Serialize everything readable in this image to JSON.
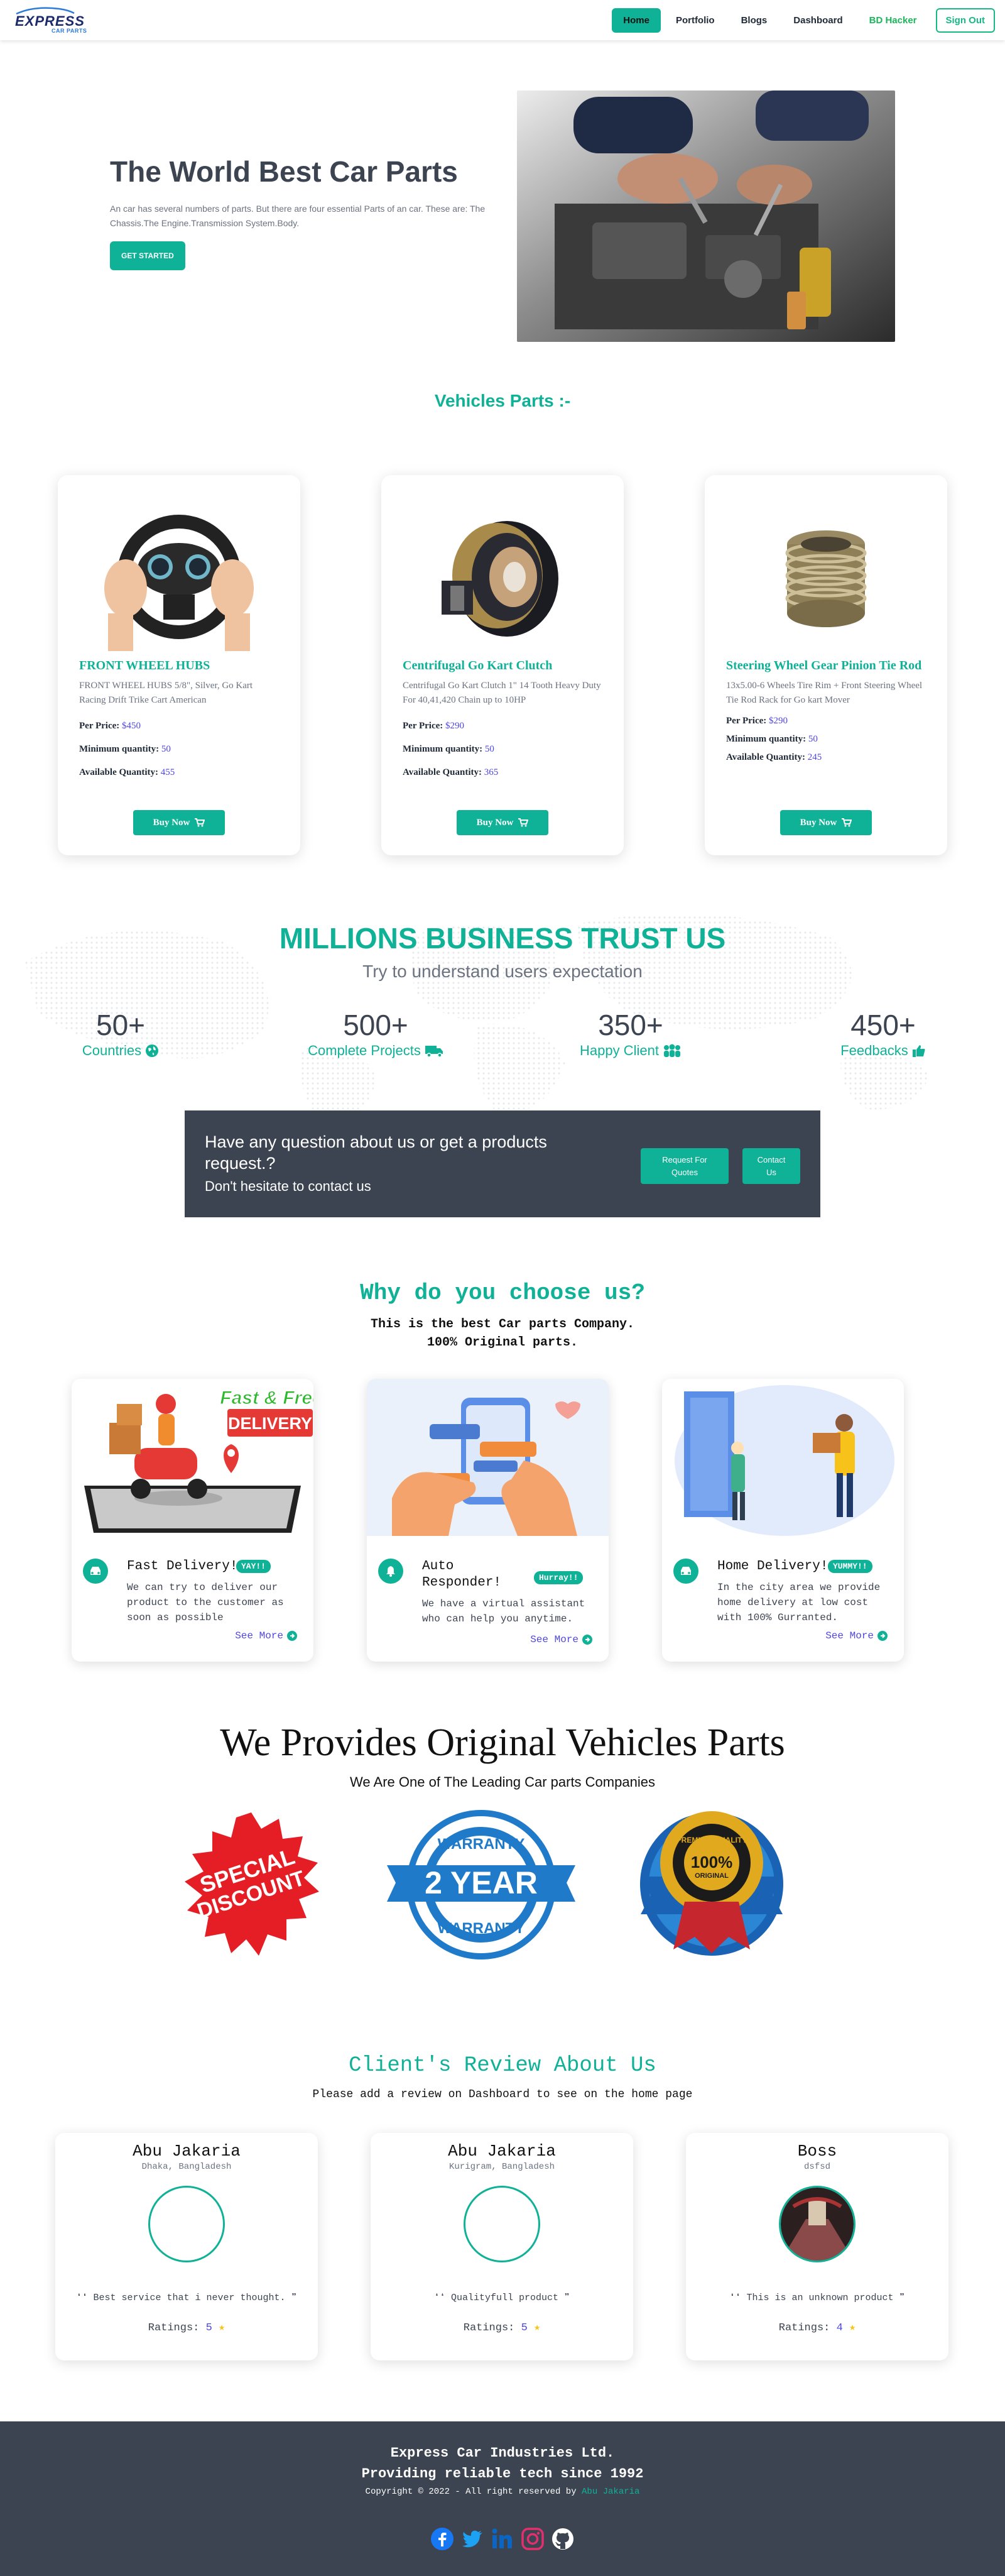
{
  "navbar": {
    "logo_main": "EXPRESS",
    "logo_sub": "CAR PARTS",
    "links": [
      "Home",
      "Portfolio",
      "Blogs",
      "Dashboard",
      "BD Hacker"
    ],
    "signout": "Sign Out"
  },
  "hero": {
    "title": "The World Best Car Parts",
    "description": "An car has several numbers of parts. But there are four essential Parts of an car. These are: The Chassis.The Engine.Transmission System.Body.",
    "button": "GET STARTED"
  },
  "parts": {
    "heading": "Vehicles Parts :-",
    "price_label": "Per Price:",
    "min_label": "Minimum quantity:",
    "avail_label": "Available Quantity:",
    "buy_label": "Buy Now",
    "items": [
      {
        "name": "FRONT WHEEL HUBS",
        "description": "FRONT WHEEL HUBS 5/8\", Silver, Go Kart Racing Drift Trike Cart American",
        "price": "$450",
        "min_qty": "50",
        "available": "455"
      },
      {
        "name": "Centrifugal Go Kart Clutch",
        "description": "Centrifugal Go Kart Clutch 1\" 14 Tooth Heavy Duty For 40,41,420 Chain up to 10HP",
        "price": "$290",
        "min_qty": "50",
        "available": "365"
      },
      {
        "name": "Steering Wheel Gear Pinion Tie Rod",
        "description": "13x5.00-6 Wheels Tire Rim + Front Steering Wheel Tie Rod Rack for Go kart Mover",
        "price": "$290",
        "min_qty": "50",
        "available": "245"
      }
    ]
  },
  "trust": {
    "title": "MILLIONS BUSINESS TRUST US",
    "subtitle": "Try to understand users expectation",
    "stats": [
      {
        "number": "50+",
        "label": "Countries",
        "icon": "globe-icon"
      },
      {
        "number": "500+",
        "label": "Complete Projects",
        "icon": "truck-icon"
      },
      {
        "number": "350+",
        "label": "Happy Client",
        "icon": "users-icon"
      },
      {
        "number": "450+",
        "label": "Feedbacks",
        "icon": "thumbs-up-icon"
      }
    ]
  },
  "contact": {
    "question": "Have any question about us or get a products request.?",
    "hint": "Don't hesitate to contact us",
    "btn_quote_l1": "Request For",
    "btn_quote_l2": "Quotes",
    "btn_contact_l1": "Contact",
    "btn_contact_l2": "Us"
  },
  "why": {
    "title": "Why do you choose us?",
    "sub_l1": "This is the best Car parts Company.",
    "sub_l2": "100% Original parts.",
    "more_label": "See More",
    "img_text_top": "Fast & Free",
    "img_text_bottom": "DELIVERY",
    "cards": [
      {
        "head": "Fast Delivery!",
        "badge": "YAY!!",
        "text": "We can try to deliver our product to the customer as soon as possible"
      },
      {
        "head_l1": "Auto",
        "head_l2": "Responder!",
        "badge": "Hurray!!",
        "text": "We have a virtual assistant who can help you anytime."
      },
      {
        "head": "Home Delivery!",
        "badge": "YUMMY!!",
        "text": "In the city area we provide home delivery at low cost with 100% Gurranted."
      }
    ]
  },
  "original": {
    "title": "We Provides Original Vehicles Parts",
    "subtitle": "We Are One of The Leading Car parts Companies",
    "badge1_l1": "SPECIAL",
    "badge1_l2": "DISCOUNT",
    "badge2_top": "WARRANTY",
    "badge2_mid": "2 YEAR",
    "badge2_bot": "WARRANTY",
    "badge3_top": "PREMIUM QUALITY",
    "badge3_mid": "100%",
    "badge3_bot": "ORIGINAL"
  },
  "reviews": {
    "title": "Client's Review About Us",
    "subtitle": "Please add a review on Dashboard to see on the home page",
    "ratings_label": "Ratings:",
    "items": [
      {
        "name": "Abu Jakaria",
        "location": "Dhaka, Bangladesh",
        "text": "❛❛ Best service that i never thought. ❞",
        "rating": "5"
      },
      {
        "name": "Abu Jakaria",
        "location": "Kurigram, Bangladesh",
        "text": "❛❛ Qualityfull product ❞",
        "rating": "5"
      },
      {
        "name": "Boss",
        "location": "dsfsd",
        "text": "❛❛ This is an unknown product ❞",
        "rating": "4"
      }
    ]
  },
  "footer": {
    "line1": "Express Car Industries Ltd.",
    "line2": "Providing reliable tech since 1992",
    "copyright": "Copyright © 2022 - All right reserved by",
    "author": "Abu Jakaria",
    "socials": [
      "facebook-icon",
      "twitter-icon",
      "linkedin-icon",
      "instagram-icon",
      "github-icon"
    ]
  },
  "colors": {
    "accent": "#0fb197",
    "dark": "#3d4451",
    "value": "#4f46e5"
  }
}
